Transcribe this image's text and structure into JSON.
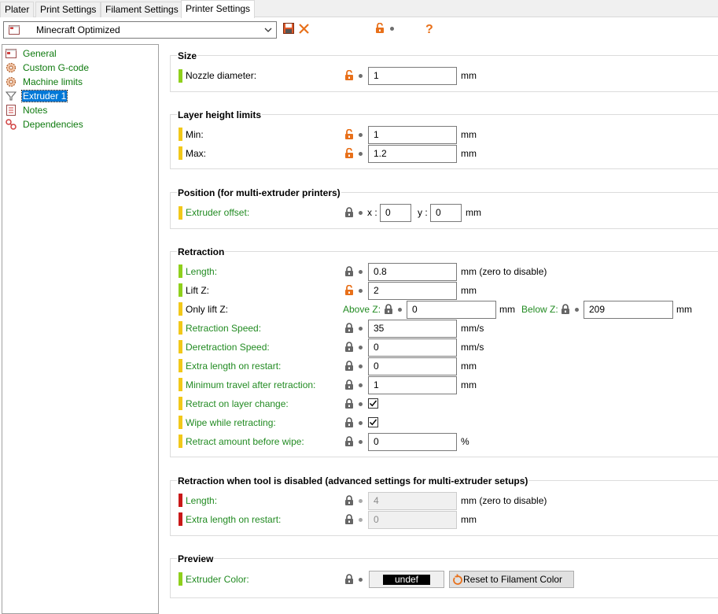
{
  "tabs": [
    {
      "label": "Plater"
    },
    {
      "label": "Print Settings"
    },
    {
      "label": "Filament Settings"
    },
    {
      "label": "Printer Settings",
      "active": true
    }
  ],
  "preset": {
    "selected": "Minecraft Optimized"
  },
  "colors": {
    "accent_orange": "#e8701a",
    "label_green": "#228b22",
    "mark_green": "#8fd01c",
    "mark_yellow": "#f2c81a",
    "mark_red": "#c91818",
    "selection_blue": "#0078d7"
  },
  "sidebar": {
    "items": [
      {
        "label": "General",
        "icon": "printer-icon"
      },
      {
        "label": "Custom G-code",
        "icon": "gear-icon"
      },
      {
        "label": "Machine limits",
        "icon": "gear-icon"
      },
      {
        "label": "Extruder 1",
        "icon": "funnel-icon",
        "selected": true
      },
      {
        "label": "Notes",
        "icon": "notes-icon"
      },
      {
        "label": "Dependencies",
        "icon": "wrench-icon"
      }
    ]
  },
  "groups": {
    "size": {
      "title": "Size",
      "nozzle": {
        "label": "Nozzle diameter:",
        "value": "1",
        "unit": "mm"
      }
    },
    "layer_height": {
      "title": "Layer height limits",
      "min": {
        "label": "Min:",
        "value": "1",
        "unit": "mm"
      },
      "max": {
        "label": "Max:",
        "value": "1.2",
        "unit": "mm"
      }
    },
    "position": {
      "title": "Position (for multi-extruder printers)",
      "offset": {
        "label": "Extruder offset:",
        "x_label": "x :",
        "x_value": "0",
        "y_label": "y :",
        "y_value": "0",
        "unit": "mm"
      }
    },
    "retraction": {
      "title": "Retraction",
      "length": {
        "label": "Length:",
        "value": "0.8",
        "unit": "mm (zero to disable)"
      },
      "lift_z": {
        "label": "Lift Z:",
        "value": "2",
        "unit": "mm"
      },
      "only_lift_z": {
        "label": "Only lift Z:",
        "above_label": "Above Z:",
        "above_value": "0",
        "above_unit": "mm",
        "below_label": "Below Z:",
        "below_value": "209",
        "below_unit": "mm"
      },
      "speed": {
        "label": "Retraction Speed:",
        "value": "35",
        "unit": "mm/s"
      },
      "deretract": {
        "label": "Deretraction Speed:",
        "value": "0",
        "unit": "mm/s"
      },
      "extra_restart": {
        "label": "Extra length on restart:",
        "value": "0",
        "unit": "mm"
      },
      "min_travel": {
        "label": "Minimum travel after retraction:",
        "value": "1",
        "unit": "mm"
      },
      "layer_change": {
        "label": "Retract on layer change:",
        "checked": true
      },
      "wipe": {
        "label": "Wipe while retracting:",
        "checked": true
      },
      "before_wipe": {
        "label": "Retract amount before wipe:",
        "value": "0",
        "unit": "%"
      }
    },
    "retraction_disabled": {
      "title": "Retraction when tool is disabled (advanced settings for multi-extruder setups)",
      "length": {
        "label": "Length:",
        "value": "4",
        "unit": "mm (zero to disable)"
      },
      "extra_restart": {
        "label": "Extra length on restart:",
        "value": "0",
        "unit": "mm"
      }
    },
    "preview": {
      "title": "Preview",
      "color": {
        "label": "Extruder Color:",
        "swatch_text": "undef",
        "reset_label": "Reset to Filament Color"
      }
    }
  }
}
